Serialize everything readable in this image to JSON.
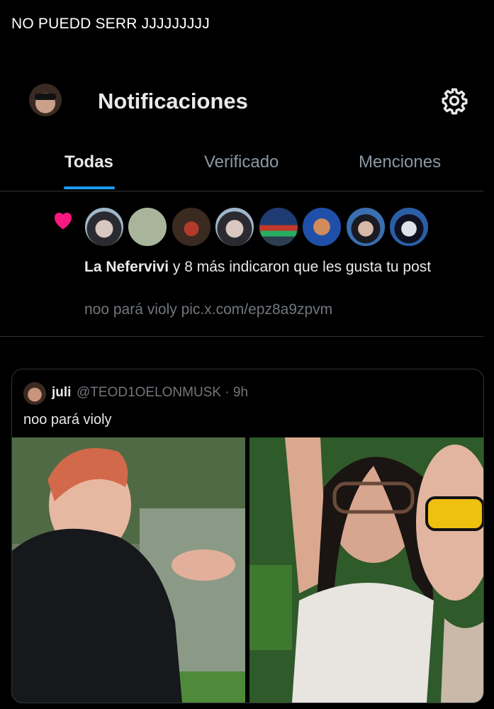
{
  "caption": "NO PUEDD SERR JJJJJJJJJ",
  "header": {
    "title": "Notificaciones"
  },
  "tabs": [
    {
      "label": "Todas",
      "active": true
    },
    {
      "label": "Verificado",
      "active": false
    },
    {
      "label": "Menciones",
      "active": false
    }
  ],
  "notification": {
    "actor": "La Nefervivi",
    "action": " y 8 más indicaron que les gusta tu post",
    "post_preview": "noo pará violy pic.x.com/epz8a9zpvm",
    "like_color": "#f91880"
  },
  "quoted_post": {
    "name": "juli",
    "meta": "@TEOD1OELONMUSK · 9h",
    "text": "noo pará violy"
  },
  "colors": {
    "accent": "#1d9bf0",
    "background": "#000000"
  }
}
